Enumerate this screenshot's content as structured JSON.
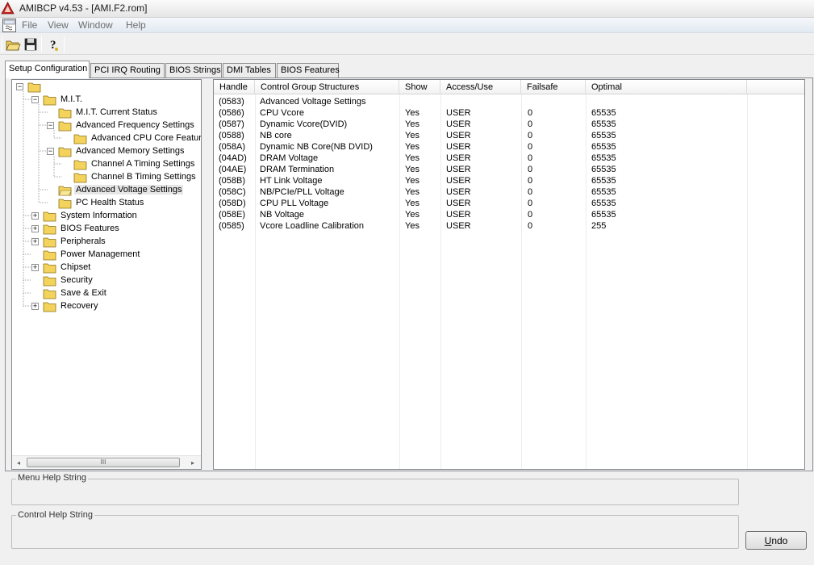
{
  "window": {
    "title": "AMIBCP v4.53 - [AMI.F2.rom]"
  },
  "menu": [
    "File",
    "View",
    "Window",
    "Help"
  ],
  "toolbar": {
    "buttons": [
      "open-icon",
      "save-icon",
      "help-icon"
    ]
  },
  "tabs": [
    "Setup Configuration",
    "PCI IRQ Routing",
    "BIOS Strings",
    "DMI Tables",
    "BIOS Features"
  ],
  "active_tab": "Setup Configuration",
  "tree": [
    {
      "label": "M.I.T."
    },
    {
      "label": "M.I.T. Current Status"
    },
    {
      "label": "Advanced Frequency Settings"
    },
    {
      "label": "Advanced CPU Core Feature"
    },
    {
      "label": "Advanced Memory Settings"
    },
    {
      "label": "Channel A Timing Settings"
    },
    {
      "label": "Channel B Timing Settings"
    },
    {
      "label": "Advanced Voltage Settings"
    },
    {
      "label": "PC Health Status"
    },
    {
      "label": "System Information"
    },
    {
      "label": "BIOS Features"
    },
    {
      "label": "Peripherals"
    },
    {
      "label": "Power Management"
    },
    {
      "label": "Chipset"
    },
    {
      "label": "Security"
    },
    {
      "label": "Save & Exit"
    },
    {
      "label": "Recovery"
    }
  ],
  "scrollbar": {
    "thumb_label": "III",
    "left_arrow": "◂",
    "right_arrow": "▸"
  },
  "grid": {
    "columns": [
      "Handle",
      "Control Group Structures",
      "Show",
      "Access/Use",
      "Failsafe",
      "Optimal"
    ],
    "rows": [
      [
        "(0583)",
        "Advanced Voltage Settings",
        "",
        "",
        "",
        ""
      ],
      [
        "(0586)",
        "CPU Vcore",
        "Yes",
        "USER",
        "0",
        "65535"
      ],
      [
        "(0587)",
        "Dynamic Vcore(DVID)",
        "Yes",
        "USER",
        "0",
        "65535"
      ],
      [
        "(0588)",
        "NB core",
        "Yes",
        "USER",
        "0",
        "65535"
      ],
      [
        "(058A)",
        "Dynamic NB Core(NB DVID)",
        "Yes",
        "USER",
        "0",
        "65535"
      ],
      [
        "(04AD)",
        "DRAM Voltage",
        "Yes",
        "USER",
        "0",
        "65535"
      ],
      [
        "(04AE)",
        "DRAM Termination",
        "Yes",
        "USER",
        "0",
        "65535"
      ],
      [
        "(058B)",
        "HT Link Voltage",
        "Yes",
        "USER",
        "0",
        "65535"
      ],
      [
        "(058C)",
        "NB/PCIe/PLL Voltage",
        "Yes",
        "USER",
        "0",
        "65535"
      ],
      [
        "(058D)",
        "CPU PLL Voltage",
        "Yes",
        "USER",
        "0",
        "65535"
      ],
      [
        "(058E)",
        "NB Voltage",
        "Yes",
        "USER",
        "0",
        "65535"
      ],
      [
        "(0585)",
        "Vcore Loadline Calibration",
        "Yes",
        "USER",
        "0",
        "255"
      ]
    ]
  },
  "help": {
    "menu_help_label": "Menu Help String",
    "control_help_label": "Control Help String"
  },
  "buttons": {
    "undo_label": "Undo",
    "undo_rest": "ndo",
    "undo_mnemonic": "U"
  }
}
